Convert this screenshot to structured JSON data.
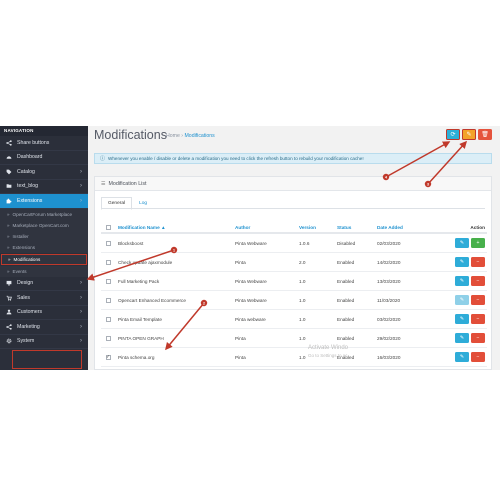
{
  "sidebar": {
    "title": "NAVIGATION",
    "items": [
      {
        "label": "Share buttons",
        "icon": "share-icon",
        "caret": ""
      },
      {
        "label": "Dashboard",
        "icon": "dashboard-icon",
        "caret": ""
      },
      {
        "label": "Catalog",
        "icon": "tag-icon",
        "caret": "›"
      },
      {
        "label": "text_blog",
        "icon": "folder-icon",
        "caret": "›"
      },
      {
        "label": "Extensions",
        "icon": "puzzle-icon",
        "caret": "›"
      }
    ],
    "sub_items": [
      {
        "label": "OpenCartForum Marketplace"
      },
      {
        "label": "Marketplace OpenCart.com"
      },
      {
        "label": "Installer"
      },
      {
        "label": "Extensions"
      },
      {
        "label": "Modifications"
      },
      {
        "label": "Events"
      }
    ],
    "bottom_items": [
      {
        "label": "Design",
        "icon": "monitor-icon",
        "caret": "›"
      },
      {
        "label": "Sales",
        "icon": "cart-icon",
        "caret": "›"
      },
      {
        "label": "Customers",
        "icon": "user-icon",
        "caret": "›"
      },
      {
        "label": "Marketing",
        "icon": "share-alt-icon",
        "caret": "›"
      },
      {
        "label": "System",
        "icon": "gear-icon",
        "caret": "›"
      }
    ]
  },
  "header": {
    "title": "Modifications",
    "breadcrumb_home": "Home",
    "breadcrumb_sep": "›",
    "breadcrumb_current": "Modifications",
    "buttons": {
      "refresh": "⟳",
      "clear": "✎",
      "delete": "🗑"
    }
  },
  "alert": {
    "icon": "info-icon",
    "text": "Whenever you enable / disable or delete a modification you need to click the refresh button to rebuild your modification cache!"
  },
  "panel": {
    "title": "Modification List",
    "tabs": [
      "General",
      "Log"
    ]
  },
  "table": {
    "headers": {
      "name": "Modification Name ▲",
      "author": "Author",
      "version": "Version",
      "status": "Status",
      "date": "Date Added",
      "action": "Action"
    },
    "rows": [
      {
        "checked": false,
        "name": "Blocksboost",
        "author": "Pinta Webware",
        "version": "1.0.6",
        "status": "Disabled",
        "date": "02/03/2020"
      },
      {
        "checked": false,
        "name": "Check update ajaxmodule",
        "author": "Pinta",
        "version": "2.0",
        "status": "Enabled",
        "date": "14/02/2020"
      },
      {
        "checked": false,
        "name": "Full Marketing Pack",
        "author": "Pinta Webware",
        "version": "1.0",
        "status": "Enabled",
        "date": "13/03/2020"
      },
      {
        "checked": false,
        "name": "Opencart Enhanced Ecommerce",
        "author": "Pinta Webware",
        "version": "1.0",
        "status": "Enabled",
        "date": "11/03/2020"
      },
      {
        "checked": false,
        "name": "Pinta Email Template",
        "author": "Pinta webware",
        "version": "1.0",
        "status": "Enabled",
        "date": "03/02/2020"
      },
      {
        "checked": false,
        "name": "PINTA OPEN GRAPH",
        "author": "Pinta",
        "version": "1.0",
        "status": "Enabled",
        "date": "29/02/2020"
      },
      {
        "checked": true,
        "name": "Pinta schema.org",
        "author": "Pinta",
        "version": "1.0",
        "status": "Enabled",
        "date": "16/03/2020"
      }
    ]
  },
  "watermark": {
    "line1": "Activate Windo",
    "line2": "Go to Settings to ac"
  },
  "annotations": [
    "1",
    "2",
    "3",
    "4"
  ],
  "colors": {
    "sidebar_bg": "#2b2f3a",
    "primary": "#1e91cf",
    "annotation": "#c0392b",
    "success": "#47b04b",
    "danger": "#e24e39",
    "warning": "#f3a32a"
  }
}
